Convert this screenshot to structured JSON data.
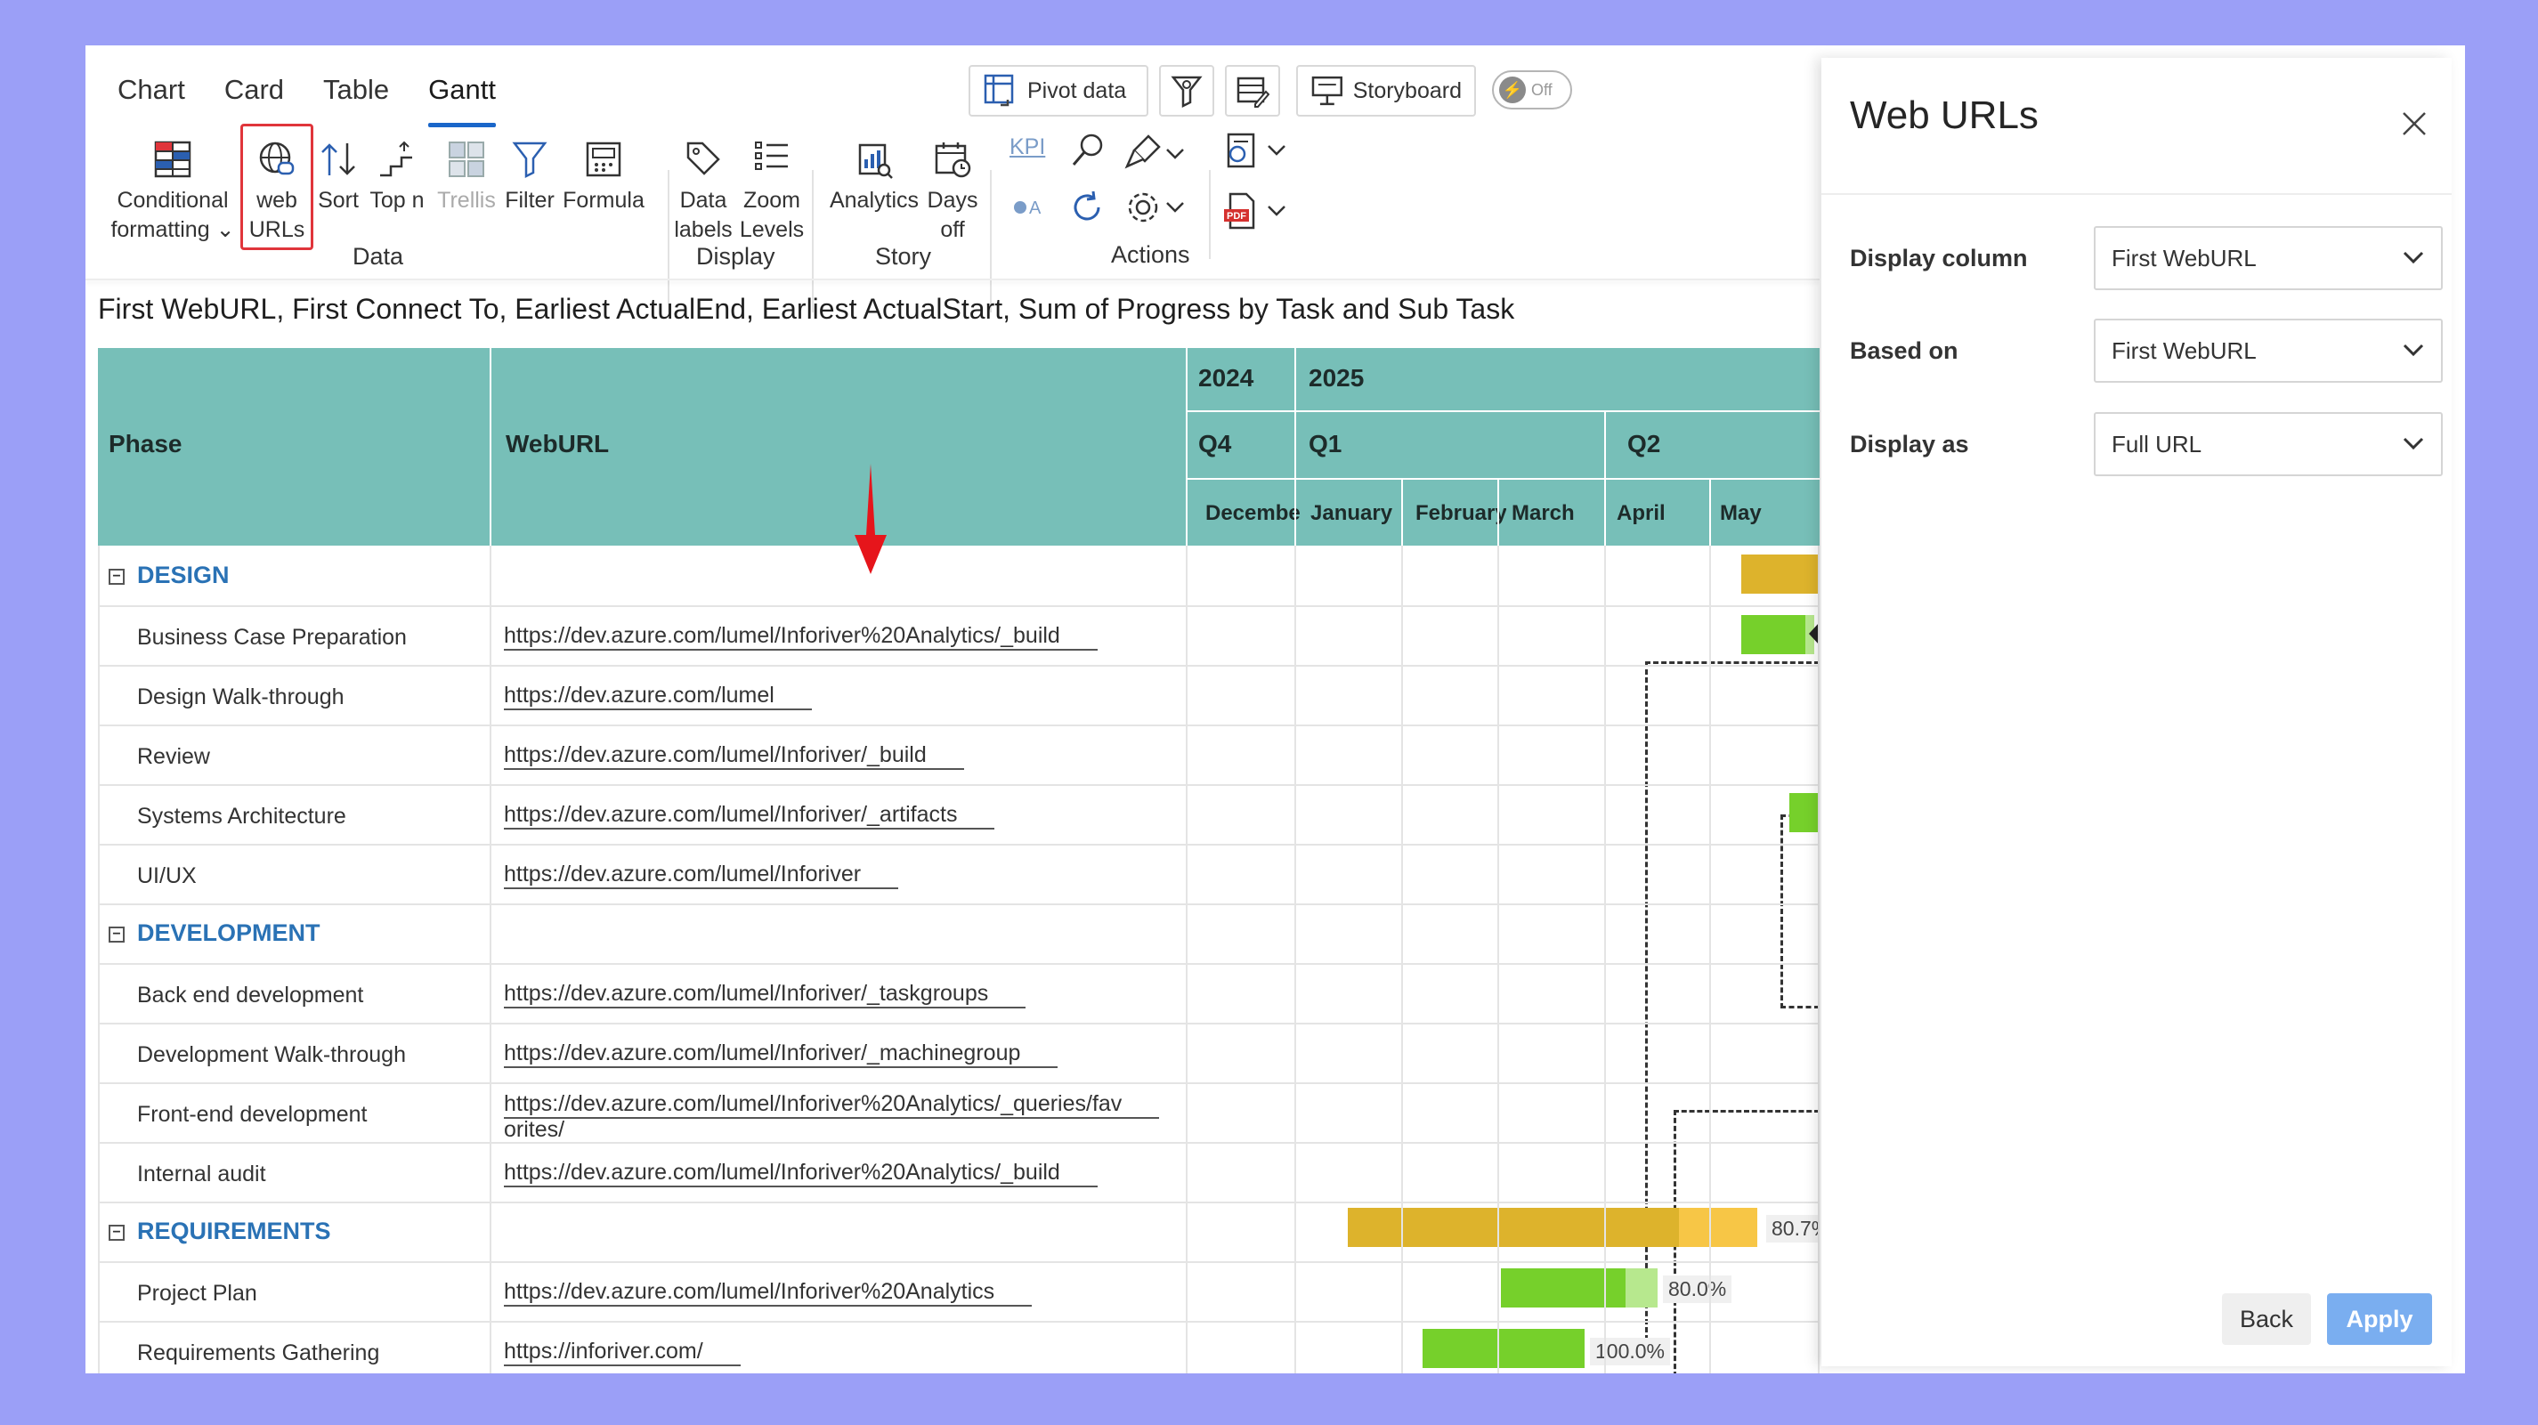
{
  "tabs": [
    {
      "label": "Chart",
      "active": false
    },
    {
      "label": "Card",
      "active": false
    },
    {
      "label": "Table",
      "active": false
    },
    {
      "label": "Gantt",
      "active": true
    }
  ],
  "toolbar": {
    "pivot_label": "Pivot data",
    "storyboard_label": "Storyboard",
    "toggle_label": "Off",
    "conditional_formatting": "Conditional",
    "conditional_formatting_2": "formatting",
    "web_urls": "web",
    "web_urls_2": "URLs",
    "sort": "Sort",
    "topn": "Top n",
    "trellis": "Trellis",
    "filter": "Filter",
    "formula": "Formula",
    "data_labels": "Data",
    "data_labels_2": "labels",
    "zoom_levels": "Zoom",
    "zoom_levels_2": "Levels",
    "analytics": "Analytics",
    "days_off": "Days",
    "days_off_2": "off",
    "kpi": "KPI",
    "group_data": "Data",
    "group_display": "Display",
    "group_story": "Story",
    "group_actions": "Actions"
  },
  "visual_title": "First WebURL, First Connect To, Earliest ActualEnd, Earliest ActualStart, Sum of Progress by Task and Sub Task",
  "table": {
    "col_phase": "Phase",
    "col_weburl": "WebURL",
    "years": [
      "2024",
      "2025"
    ],
    "quarters": [
      "Q4",
      "Q1",
      "Q2"
    ],
    "months": [
      "Decembe",
      "January",
      "February",
      "March",
      "April",
      "May"
    ],
    "rows": [
      {
        "type": "group",
        "phase": "DESIGN",
        "url": ""
      },
      {
        "type": "task",
        "phase": "Business Case Preparation",
        "url": "https://dev.azure.com/lumel/Inforiver%20Analytics/_build"
      },
      {
        "type": "task",
        "phase": "Design Walk-through",
        "url": "https://dev.azure.com/lumel"
      },
      {
        "type": "task",
        "phase": "Review",
        "url": "https://dev.azure.com/lumel/Inforiver/_build"
      },
      {
        "type": "task",
        "phase": "Systems Architecture",
        "url": "https://dev.azure.com/lumel/Inforiver/_artifacts"
      },
      {
        "type": "task",
        "phase": "UI/UX",
        "url": "https://dev.azure.com/lumel/Inforiver"
      },
      {
        "type": "group",
        "phase": "DEVELOPMENT",
        "url": ""
      },
      {
        "type": "task",
        "phase": "Back end development",
        "url": "https://dev.azure.com/lumel/Inforiver/_taskgroups"
      },
      {
        "type": "task",
        "phase": "Development Walk-through",
        "url": "https://dev.azure.com/lumel/Inforiver/_machinegroup"
      },
      {
        "type": "task",
        "phase": "Front-end development",
        "url": "https://dev.azure.com/lumel/Inforiver%20Analytics/_queries/fav",
        "url_cont": "orites/"
      },
      {
        "type": "task",
        "phase": "Internal audit",
        "url": "https://dev.azure.com/lumel/Inforiver%20Analytics/_build"
      },
      {
        "type": "group",
        "phase": "REQUIREMENTS",
        "url": ""
      },
      {
        "type": "task",
        "phase": "Project Plan",
        "url": "https://dev.azure.com/lumel/Inforiver%20Analytics"
      },
      {
        "type": "task",
        "phase": "Requirements Gathering",
        "url": "https://inforiver.com/"
      }
    ],
    "progress_labels": [
      "80.7%",
      "80.0%",
      "100.0%"
    ]
  },
  "colors": {
    "header_bg": "#77bfb8",
    "group_bar": "#ddb32c",
    "group_bar_rest": "#f7c646",
    "task_bar": "#76d02b",
    "task_bar_rest": "#b7e88e",
    "link_blue": "#2a72b5",
    "apply_blue": "#7aaef0"
  },
  "pane": {
    "title": "Web URLs",
    "fields": [
      {
        "label": "Display column",
        "value": "First WebURL"
      },
      {
        "label": "Based on",
        "value": "First WebURL"
      },
      {
        "label": "Display as",
        "value": "Full URL"
      }
    ],
    "back_label": "Back",
    "apply_label": "Apply"
  }
}
